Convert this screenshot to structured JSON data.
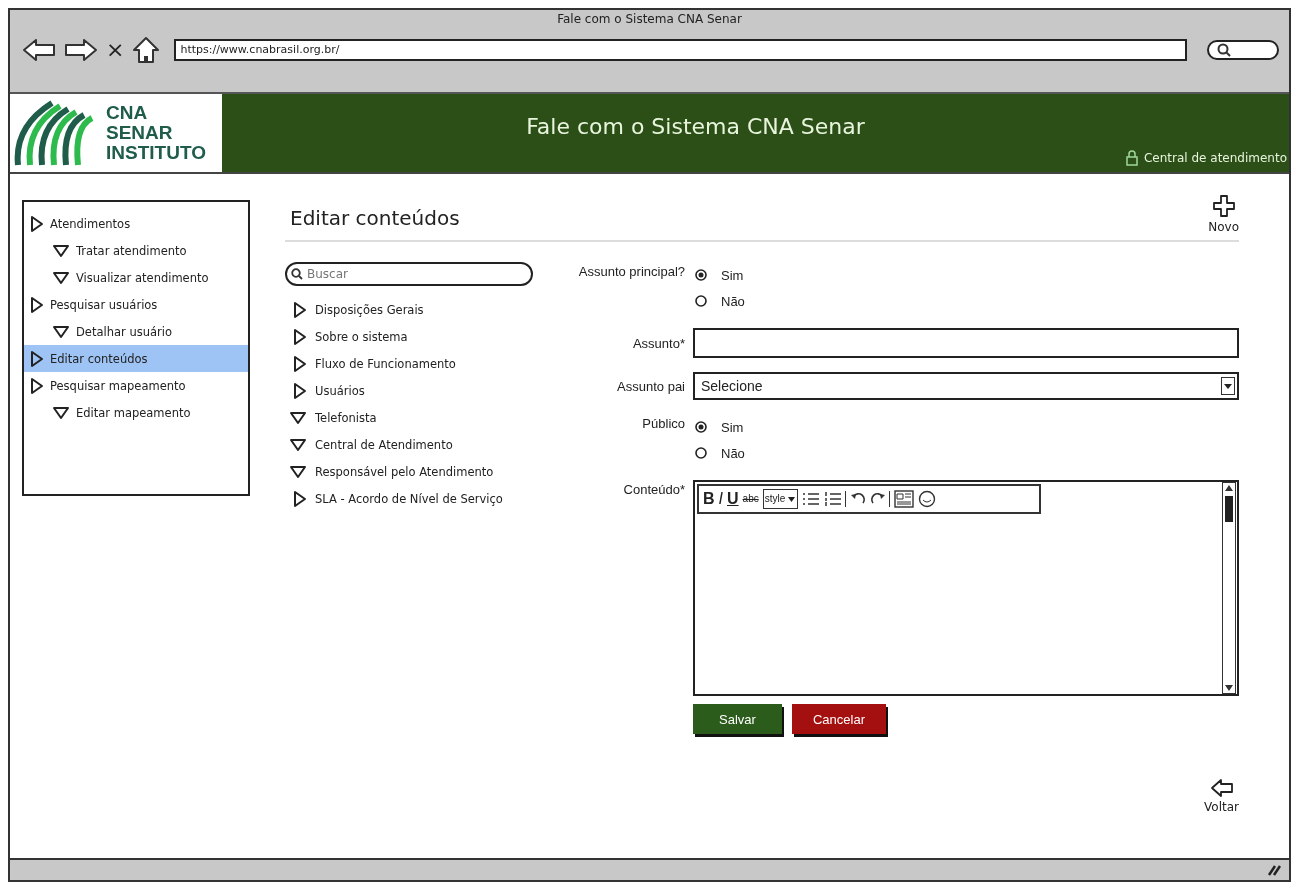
{
  "browser": {
    "title": "Fale com o Sistema CNA Senar",
    "close_glyph": "×",
    "url": "https://www.cnabrasil.org.br/"
  },
  "header": {
    "logo": [
      "CNA",
      "SENAR",
      "INSTITUTO"
    ],
    "title": "Fale com o Sistema CNA Senar",
    "user_link": "Central de atendimento"
  },
  "sidebar": {
    "items": [
      {
        "label": "Atendimentos",
        "expanded": false,
        "selected": false,
        "children": [
          {
            "label": "Tratar atendimento",
            "expanded": true,
            "selected": false
          },
          {
            "label": "Visualizar atendimento",
            "expanded": true,
            "selected": false
          }
        ]
      },
      {
        "label": "Pesquisar usuários",
        "expanded": false,
        "selected": false,
        "children": [
          {
            "label": "Detalhar usuário",
            "expanded": true,
            "selected": false
          }
        ]
      },
      {
        "label": "Editar conteúdos",
        "expanded": false,
        "selected": true
      },
      {
        "label": "Pesquisar mapeamento",
        "expanded": false,
        "selected": false,
        "children": [
          {
            "label": "Editar mapeamento",
            "expanded": true,
            "selected": false
          }
        ]
      }
    ]
  },
  "page": {
    "title": "Editar conteúdos",
    "new_button": "Novo",
    "back_button": "Voltar"
  },
  "topics": {
    "search": {
      "placeholder": "Buscar"
    },
    "items": [
      {
        "label": "Disposições Gerais",
        "expanded": false
      },
      {
        "label": "Sobre o sistema",
        "expanded": false
      },
      {
        "label": "Fluxo de Funcionamento",
        "expanded": false
      },
      {
        "label": "Usuários",
        "expanded": false
      },
      {
        "label": "Telefonista",
        "expanded": true
      },
      {
        "label": "Central de Atendimento",
        "expanded": true
      },
      {
        "label": "Responsável pelo Atendimento",
        "expanded": true
      },
      {
        "label": "SLA - Acordo de Nível de Serviço",
        "expanded": false
      }
    ]
  },
  "form": {
    "fields": [
      {
        "kind": "radio",
        "label": "Assunto principal?",
        "options": [
          {
            "label": "Sim",
            "selected": true
          },
          {
            "label": "Não",
            "selected": false
          }
        ]
      },
      {
        "kind": "text",
        "label": "Assunto*"
      },
      {
        "kind": "select",
        "label": "Assunto pai",
        "value": "Selecione"
      },
      {
        "kind": "radio",
        "label": "Público",
        "options": [
          {
            "label": "Sim",
            "selected": true
          },
          {
            "label": "Não",
            "selected": false
          }
        ]
      },
      {
        "kind": "editor",
        "label": "Conteúdo*",
        "toolbar": [
          {
            "kind": "bold",
            "label": "B"
          },
          {
            "kind": "italic",
            "label": "I"
          },
          {
            "kind": "underline",
            "label": "U"
          },
          {
            "kind": "strike",
            "label": "abc"
          },
          {
            "kind": "dropdown",
            "label": "style"
          },
          {
            "kind": "bullets"
          },
          {
            "kind": "numbers"
          },
          {
            "kind": "undo"
          },
          {
            "kind": "redo"
          },
          {
            "kind": "image"
          },
          {
            "kind": "emoji"
          }
        ]
      }
    ],
    "buttons": [
      {
        "kind": "primary",
        "label": "Salvar"
      },
      {
        "kind": "danger",
        "label": "Cancelar"
      }
    ]
  }
}
